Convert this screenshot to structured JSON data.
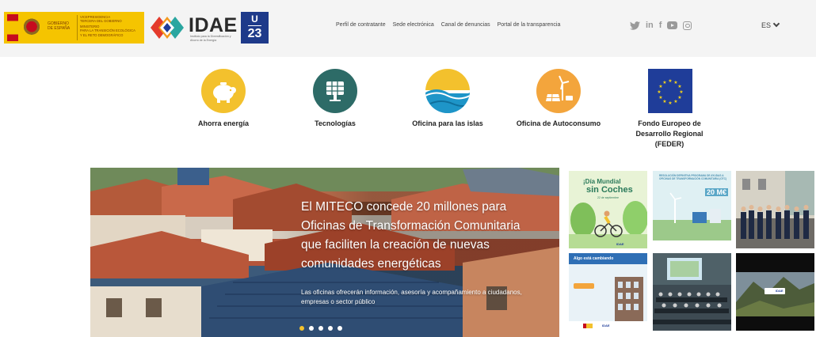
{
  "header": {
    "gov_logo": {
      "line1": "GOBIERNO",
      "line2": "DE ESPAÑA",
      "ministry_1": "VICEPRESIDENCIA",
      "ministry_2": "TERCERA DEL GOBIERNO",
      "ministry_3": "MINISTERIO",
      "ministry_4": "PARA LA TRANSICIÓN ECOLÓGICA",
      "ministry_5": "Y EL RETO DEMOGRÁFICO"
    },
    "idae_logo": {
      "name": "IDAE",
      "subtitle": "Instituto para la Diversificación y Ahorro de la Energía"
    },
    "u23": {
      "top": "U",
      "bottom": "23"
    },
    "links": [
      "Perfil de contratante",
      "Sede electrónica",
      "Canal de denuncias",
      "Portal de la transparencia"
    ],
    "social": {
      "twitter": "twitter-icon",
      "linkedin": "in",
      "facebook": "f",
      "youtube": "youtube-icon",
      "instagram": "instagram-icon"
    },
    "language": "ES"
  },
  "quick_links": [
    {
      "label": "Ahorra energía",
      "icon": "piggy-bank-icon",
      "color": "#f3c12d"
    },
    {
      "label": "Tecnologías",
      "icon": "solar-panel-icon",
      "color": "#2d6b67"
    },
    {
      "label": "Oficina para las islas",
      "icon": "island-wave-icon",
      "color": "#1e95c8"
    },
    {
      "label": "Oficina de Autoconsumo",
      "icon": "wind-solar-icon",
      "color": "#f3a53c"
    },
    {
      "label": "Fondo Europeo de Desarrollo Regional (FEDER)",
      "icon": "eu-flag-icon",
      "color": "#1f3d99"
    }
  ],
  "hero": {
    "title": "El MITECO concede 20 millones para Oficinas de Transformación Comunitaria que faciliten la creación de nuevas comunidades energéticas",
    "subtitle": "Las oficinas ofrecerán información, asesoría y acompañamiento a ciudadanos, empresas o sector público",
    "slide_count": 5,
    "active_slide": 0
  },
  "thumbnails": [
    {
      "name": "dia-mundial-sin-coches",
      "line1": "¡Día Mundial",
      "line2": "sin Coches",
      "date": "22 de septiembre",
      "brand": "IDAE"
    },
    {
      "name": "oficinas-transformacion",
      "caption": "RESOLUCIÓN DEFINITIVA PROGRAMA DE AYUDAS A OFICINAS DE TRANSFORMACIÓN COMUNITARIA (OTC)",
      "amount": "20 M€"
    },
    {
      "name": "event-photo-group"
    },
    {
      "name": "algo-esta-cambiando",
      "line1": "Algo está cambiando",
      "brand": "IDAE"
    },
    {
      "name": "conference-photo"
    },
    {
      "name": "mountain-video",
      "brand": "IDAE"
    }
  ]
}
